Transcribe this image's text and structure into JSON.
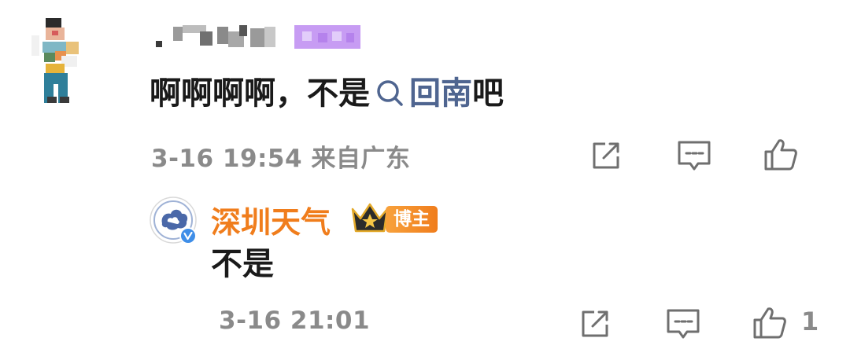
{
  "comment": {
    "text_before": "啊啊啊啊，不是",
    "link_text": "回南",
    "text_after": "吧",
    "time": "3-16 19:54",
    "location": "来自广东"
  },
  "reply": {
    "username": "深圳天气",
    "badge": "博主",
    "text": "不是",
    "time": "3-16 21:01",
    "like_count": "1"
  },
  "icons": {
    "share": "share-icon",
    "comment": "comment-icon",
    "like": "thumb-up-icon",
    "search": "search-icon",
    "verified": "verified-icon",
    "crown": "crown-icon"
  },
  "colors": {
    "link": "#4f6590",
    "reply_name": "#f07d1c",
    "meta": "#8a8a8a",
    "badge_purple": "#c79cf3"
  }
}
